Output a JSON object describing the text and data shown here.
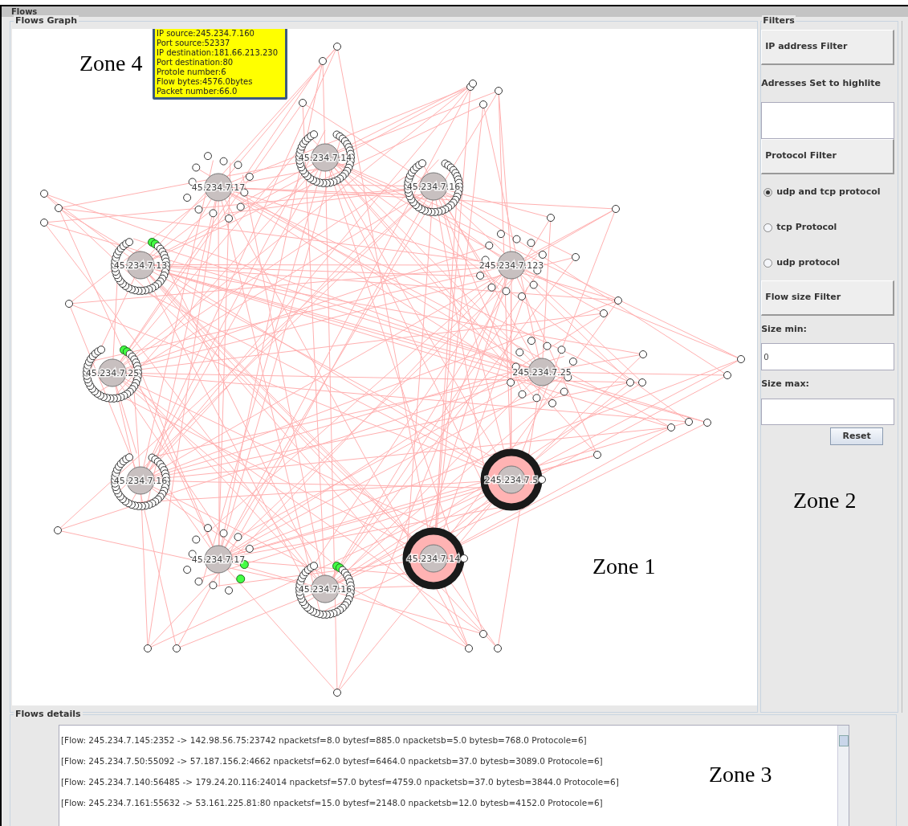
{
  "window": {
    "title": "Flows"
  },
  "graph": {
    "title": "Flows Graph",
    "nodes": [
      {
        "label": "45.234.7.17",
        "kind": "sparse",
        "highlighted": false
      },
      {
        "label": "45.234.7.14",
        "kind": "ring",
        "highlighted": false
      },
      {
        "label": "45.234.7.16",
        "kind": "ring",
        "highlighted": false
      },
      {
        "label": "45.234.7.13",
        "kind": "ring",
        "highlighted": true
      },
      {
        "label": "245.234.7.123",
        "kind": "sparse",
        "highlighted": false
      },
      {
        "label": "45.234.7.25",
        "kind": "ring",
        "highlighted": true
      },
      {
        "label": "245.234.7.25",
        "kind": "sparse",
        "highlighted": false
      },
      {
        "label": "45.234.7.16",
        "kind": "ring",
        "highlighted": false
      },
      {
        "label": "45.234.7.17",
        "kind": "sparse",
        "highlighted": true
      },
      {
        "label": "45.234.7.16",
        "kind": "ring",
        "highlighted": true
      },
      {
        "label": "45.234.7.14",
        "kind": "dense",
        "highlighted": false
      },
      {
        "label": "245.234.7.5",
        "kind": "dense",
        "highlighted": false
      }
    ],
    "tooltip": [
      "IP source:245.234.7.160",
      "Port source:52337",
      "IP destination:181.66.213.230",
      "Port destination:80",
      "Protole number:6",
      "Flow bytes:4576.0bytes",
      "Packet number:66.0"
    ]
  },
  "filters": {
    "title": "Filters",
    "ip_filter_button": "IP address Filter",
    "addresses_label": "Adresses Set to highlite",
    "protocol_filter_button": "Protocol Filter",
    "protocols": [
      {
        "label": "udp and tcp protocol",
        "selected": true
      },
      {
        "label": "tcp Protocol",
        "selected": false
      },
      {
        "label": "udp protocol",
        "selected": false
      }
    ],
    "size_filter_button": "Flow size Filter",
    "size_min_label": "Size min:",
    "size_min_value": "0",
    "size_max_label": "Size max:",
    "reset_button": "Reset"
  },
  "details": {
    "title": "Flows details",
    "rows": [
      "[Flow: 245.234.7.145:2352 -> 142.98.56.75:23742 npacketsf=8.0 bytesf=885.0 npacketsb=5.0 bytesb=768.0 Protocole=6]",
      "[Flow: 245.234.7.50:55092 -> 57.187.156.2:4662 npacketsf=62.0 bytesf=6464.0 npacketsb=37.0 bytesb=3089.0 Protocole=6]",
      "[Flow: 245.234.7.140:56485 -> 179.24.20.116:24014 npacketsf=57.0 bytesf=4759.0 npacketsb=37.0 bytesb=3844.0 Protocole=6]",
      "[Flow: 245.234.7.161:55632 -> 53.161.225.81:80 npacketsf=15.0 bytesf=2148.0 npacketsb=12.0 bytesb=4152.0 Protocole=6]"
    ]
  },
  "annotations": [
    "Zone 4",
    "Zone 1",
    "Zone 2",
    "Zone 3"
  ]
}
